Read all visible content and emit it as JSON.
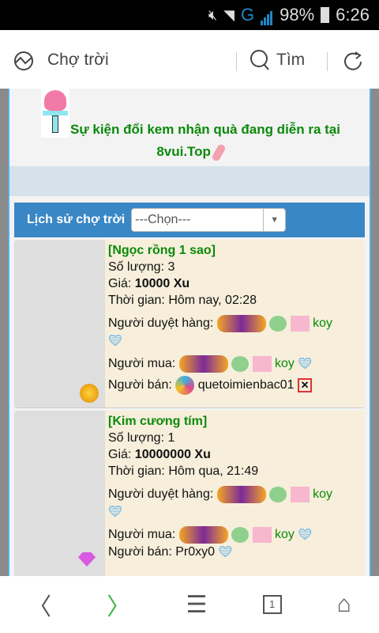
{
  "status": {
    "battery": "98%",
    "time": "6:26",
    "network": "G"
  },
  "toolbar": {
    "title": "Chợ trời",
    "search_label": "Tìm"
  },
  "banner": {
    "text": "Sự kiện đổi kem nhận quà đang diễn ra tại",
    "site": "8vui.Top"
  },
  "history": {
    "label": "Lịch sử chợ trời",
    "select_value": "---Chọn---"
  },
  "labels": {
    "qty": "Số lượng: ",
    "price": "Giá: ",
    "time": "Thời gian: ",
    "approver": "Người duyệt hàng: ",
    "buyer": "Người mua: ",
    "seller": "Người bán: "
  },
  "items": [
    {
      "name": "[Ngọc rồng 1 sao]",
      "qty": "3",
      "price": "10000 Xu",
      "time": "Hôm nay, 02:28",
      "approver": "koy",
      "buyer": "koy",
      "seller": "quetoimienbac01"
    },
    {
      "name": "[Kim cương tím]",
      "qty": "1",
      "price": "10000000 Xu",
      "time": "Hôm qua, 21:49",
      "approver": "koy",
      "buyer": "koy",
      "seller": "Pr0xy0"
    }
  ],
  "nav": {
    "tab_count": "1"
  }
}
